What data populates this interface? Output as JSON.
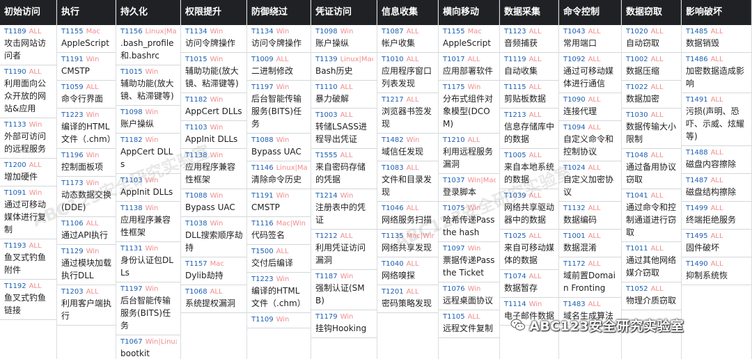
{
  "columns": [
    {
      "title": "初始访问",
      "items": [
        {
          "id": "T1189",
          "plat": "ALL",
          "name": "攻击网站访问者"
        },
        {
          "id": "T1190",
          "plat": "ALL",
          "name": "利用面向公众开放的网站&应用"
        },
        {
          "id": "T1133",
          "plat": "Win",
          "name": "外部可访问的远程服务"
        },
        {
          "id": "T1200",
          "plat": "ALL",
          "name": "增加硬件"
        },
        {
          "id": "T1091",
          "plat": "Win",
          "name": "通过可移动媒体进行复制"
        },
        {
          "id": "T1193",
          "plat": "ALL",
          "name": "鱼叉式钓鱼附件"
        },
        {
          "id": "T1192",
          "plat": "ALL",
          "name": "鱼叉式钓鱼链接"
        }
      ]
    },
    {
      "title": "执行",
      "items": [
        {
          "id": "T1155",
          "plat": "Mac",
          "name": "AppleScript"
        },
        {
          "id": "T1191",
          "plat": "Win",
          "name": "CMSTP"
        },
        {
          "id": "T1059",
          "plat": "ALL",
          "name": "命令行界面"
        },
        {
          "id": "T1223",
          "plat": "Win",
          "name": "编译的HTML文件（.chm）"
        },
        {
          "id": "T1196",
          "plat": "Win",
          "name": "控制面板项"
        },
        {
          "id": "T1173",
          "plat": "Win",
          "name": "动态数据交换(DDE)"
        },
        {
          "id": "T1106",
          "plat": "ALL",
          "name": "通过API执行"
        },
        {
          "id": "T1129",
          "plat": "Win",
          "name": "通过模块加载执行DLL"
        },
        {
          "id": "T1203",
          "plat": "ALL",
          "name": "利用客户端执行"
        }
      ]
    },
    {
      "title": "持久化",
      "items": [
        {
          "id": "T1156",
          "plat": "Linux|Mac",
          "name": ".bash_profile和.bashrc"
        },
        {
          "id": "T1015",
          "plat": "Win",
          "name": "辅助功能(放大镜、粘滞键等)"
        },
        {
          "id": "T1098",
          "plat": "Win",
          "name": "账户操纵"
        },
        {
          "id": "T1182",
          "plat": "Win",
          "name": "AppCert DLLs"
        },
        {
          "id": "T1103",
          "plat": "Win",
          "name": "AppInit DLLs"
        },
        {
          "id": "T1138",
          "plat": "Win",
          "name": "应用程序兼容性框架"
        },
        {
          "id": "T1131",
          "plat": "Win",
          "name": "身份认证包DLLs"
        },
        {
          "id": "T1197",
          "plat": "Win",
          "name": "后台智能传输服务(BITS)任务"
        },
        {
          "id": "T1067",
          "plat": "Win|Linux",
          "name": "bootkit"
        }
      ]
    },
    {
      "title": "权限提升",
      "items": [
        {
          "id": "T1134",
          "plat": "Win",
          "name": "访问令牌操作"
        },
        {
          "id": "T1015",
          "plat": "Win",
          "name": "辅助功能(放大镜、粘滞键等)"
        },
        {
          "id": "T1182",
          "plat": "Win",
          "name": "AppCert DLLs"
        },
        {
          "id": "T1103",
          "plat": "Win",
          "name": "AppInit DLLs"
        },
        {
          "id": "T1138",
          "plat": "Win",
          "name": "应用程序兼容性框架"
        },
        {
          "id": "T1088",
          "plat": "Win",
          "name": "Bypass UAC"
        },
        {
          "id": "T1038",
          "plat": "Win",
          "name": "DLL搜索顺序劫持"
        },
        {
          "id": "T1157",
          "plat": "Mac",
          "name": "Dylib劫持"
        },
        {
          "id": "T1068",
          "plat": "ALL",
          "name": "系统提权漏洞"
        }
      ]
    },
    {
      "title": "防御绕过",
      "items": [
        {
          "id": "T1134",
          "plat": "Win",
          "name": "访问令牌操作"
        },
        {
          "id": "T1009",
          "plat": "ALL",
          "name": "二进制修改"
        },
        {
          "id": "T1197",
          "plat": "Win",
          "name": "后台智能传输服务(BITS)任务"
        },
        {
          "id": "T1088",
          "plat": "Win",
          "name": "Bypass UAC"
        },
        {
          "id": "T1146",
          "plat": "Linux|Mac",
          "name": "清除命令历史"
        },
        {
          "id": "T1191",
          "plat": "Win",
          "name": "CMSTP"
        },
        {
          "id": "T1116",
          "plat": "Mac|Win",
          "name": "代码签名"
        },
        {
          "id": "T1500",
          "plat": "ALL",
          "name": "交付后编译"
        },
        {
          "id": "T1223",
          "plat": "Win",
          "name": "编译的HTML文件（.chm）"
        },
        {
          "id": "T1109",
          "plat": "Win",
          "name": ""
        }
      ]
    },
    {
      "title": "凭证访问",
      "items": [
        {
          "id": "T1098",
          "plat": "Win",
          "name": "账户操纵"
        },
        {
          "id": "T1139",
          "plat": "Linux|Mac",
          "name": "Bash历史"
        },
        {
          "id": "T1110",
          "plat": "ALL",
          "name": "暴力破解"
        },
        {
          "id": "T1003",
          "plat": "ALL",
          "name": "转储LSASS进程导出凭证"
        },
        {
          "id": "T1555",
          "plat": "ALL",
          "name": "来自密码存储的凭据"
        },
        {
          "id": "T1214",
          "plat": "Win",
          "name": "注册表中的凭证"
        },
        {
          "id": "T1212",
          "plat": "ALL",
          "name": "利用凭证访问漏洞"
        },
        {
          "id": "T1187",
          "plat": "Win",
          "name": "强制认证(SMB)"
        },
        {
          "id": "T1179",
          "plat": "Win",
          "name": "挂钩Hooking"
        }
      ]
    },
    {
      "title": "信息收集",
      "items": [
        {
          "id": "T1087",
          "plat": "ALL",
          "name": "帐户收集"
        },
        {
          "id": "T1010",
          "plat": "ALL",
          "name": "应用程序窗口列表发现"
        },
        {
          "id": "T1217",
          "plat": "ALL",
          "name": "浏览器书签发现"
        },
        {
          "id": "T1482",
          "plat": "Win",
          "name": "域信任发现"
        },
        {
          "id": "T1083",
          "plat": "ALL",
          "name": "文件和目录发现"
        },
        {
          "id": "T1046",
          "plat": "ALL",
          "name": "网络服务扫描"
        },
        {
          "id": "T1135",
          "plat": "Mac|Win",
          "name": "网络共享发现"
        },
        {
          "id": "T1040",
          "plat": "ALL",
          "name": "网络嗅探"
        },
        {
          "id": "T1201",
          "plat": "ALL",
          "name": "密码策略发现"
        }
      ]
    },
    {
      "title": "横向移动",
      "items": [
        {
          "id": "T1155",
          "plat": "Mac",
          "name": "AppleScript"
        },
        {
          "id": "T1017",
          "plat": "ALL",
          "name": "应用部署软件"
        },
        {
          "id": "T1175",
          "plat": "Win",
          "name": "分布式组件对象模型(DCOM)"
        },
        {
          "id": "T1210",
          "plat": "ALL",
          "name": "利用远程服务漏洞"
        },
        {
          "id": "T1037",
          "plat": "Win|Mac",
          "name": "登录脚本"
        },
        {
          "id": "T1075",
          "plat": "Win",
          "name": "哈希传递Pass the hash"
        },
        {
          "id": "T1097",
          "plat": "Win",
          "name": "票据传递Pass the Ticket"
        },
        {
          "id": "T1076",
          "plat": "Win",
          "name": "远程桌面协议"
        },
        {
          "id": "T1105",
          "plat": "ALL",
          "name": "远程文件复制"
        }
      ]
    },
    {
      "title": "数据采集",
      "items": [
        {
          "id": "T1123",
          "plat": "ALL",
          "name": "音频捕获"
        },
        {
          "id": "T1119",
          "plat": "ALL",
          "name": "自动收集"
        },
        {
          "id": "T1115",
          "plat": "ALL",
          "name": "剪贴板数据"
        },
        {
          "id": "T1213",
          "plat": "ALL",
          "name": "信息存储库中的数据"
        },
        {
          "id": "T1005",
          "plat": "ALL",
          "name": "来自本地系统的数据"
        },
        {
          "id": "T1039",
          "plat": "ALL",
          "name": "网络共享驱动器中的数据"
        },
        {
          "id": "T1025",
          "plat": "ALL",
          "name": "来自可移动媒体的数据"
        },
        {
          "id": "T1074",
          "plat": "ALL",
          "name": "数据暂存"
        },
        {
          "id": "T1114",
          "plat": "Win",
          "name": "电子邮件数据"
        }
      ]
    },
    {
      "title": "命令控制",
      "items": [
        {
          "id": "T1043",
          "plat": "ALL",
          "name": "常用端口"
        },
        {
          "id": "T1092",
          "plat": "ALL",
          "name": "通过可移动媒体进行通信"
        },
        {
          "id": "T1090",
          "plat": "ALL",
          "name": "连接代理"
        },
        {
          "id": "T1094",
          "plat": "ALL",
          "name": "自定义命令和控制协议"
        },
        {
          "id": "T1024",
          "plat": "ALL",
          "name": "自定义加密协议"
        },
        {
          "id": "T1132",
          "plat": "ALL",
          "name": "数据编码"
        },
        {
          "id": "T1001",
          "plat": "ALL",
          "name": "数据混淆"
        },
        {
          "id": "T1172",
          "plat": "ALL",
          "name": "域前置Domain Fronting"
        },
        {
          "id": "T1483",
          "plat": "ALL",
          "name": "域名生成算法"
        }
      ]
    },
    {
      "title": "数据窃取",
      "items": [
        {
          "id": "T1020",
          "plat": "ALL",
          "name": "自动窃取"
        },
        {
          "id": "T1002",
          "plat": "ALL",
          "name": "数据压缩"
        },
        {
          "id": "T1022",
          "plat": "ALL",
          "name": "数据加密"
        },
        {
          "id": "T1030",
          "plat": "ALL",
          "name": "数据传输大小限制"
        },
        {
          "id": "T1048",
          "plat": "ALL",
          "name": "通过备用协议窃取"
        },
        {
          "id": "T1041",
          "plat": "ALL",
          "name": "通过命令和控制通道进行窃取"
        },
        {
          "id": "T1011",
          "plat": "ALL",
          "name": "通过其他网络媒介窃取"
        },
        {
          "id": "T1052",
          "plat": "ALL",
          "name": "物理介质窃取"
        }
      ]
    },
    {
      "title": "影响破坏",
      "items": [
        {
          "id": "T1485",
          "plat": "ALL",
          "name": "数据销毁"
        },
        {
          "id": "T1486",
          "plat": "ALL",
          "name": "加密数据造成影响"
        },
        {
          "id": "T1491",
          "plat": "ALL",
          "name": "污损(声明、恐吓、示威、炫耀等)"
        },
        {
          "id": "T1488",
          "plat": "ALL",
          "name": "磁盘内容擦除"
        },
        {
          "id": "T1487",
          "plat": "ALL",
          "name": "磁盘结构擦除"
        },
        {
          "id": "T1499",
          "plat": "ALL",
          "name": "终端拒绝服务"
        },
        {
          "id": "T1495",
          "plat": "ALL",
          "name": "固件破坏"
        },
        {
          "id": "T1490",
          "plat": "ALL",
          "name": "抑制系统恢"
        }
      ]
    }
  ],
  "watermark_text": "ABC123安全研究实验室",
  "badge": {
    "icon": "wechat-icon",
    "text": "ABC123安全研究实验室"
  },
  "colors": {
    "header_bg": "#202124",
    "header_text": "#ffffff",
    "technique_id": "#1a5fb4",
    "platform": "#f28b8b"
  }
}
